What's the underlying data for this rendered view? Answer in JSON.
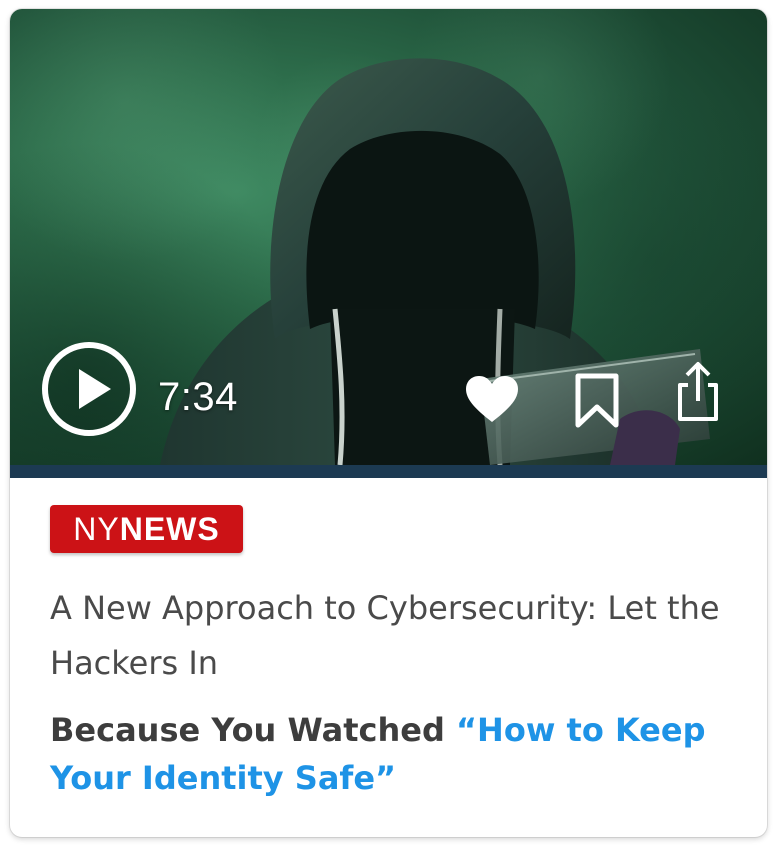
{
  "video": {
    "duration": "7:34",
    "progress_fraction": 0.0
  },
  "icons": {
    "play": "play-circle-icon",
    "like": "heart-icon",
    "bookmark": "bookmark-icon",
    "share": "share-icon"
  },
  "source": {
    "prefix": "NY",
    "name": "NEWS",
    "badge_color": "#cc1216"
  },
  "article": {
    "title": "A New Approach to Cybersecurity: Let the Hackers In"
  },
  "recommendation": {
    "prefix": "Because You Watched ",
    "link_text": "“How to Keep Your Identity Safe”",
    "link_color": "#1e93e6"
  }
}
